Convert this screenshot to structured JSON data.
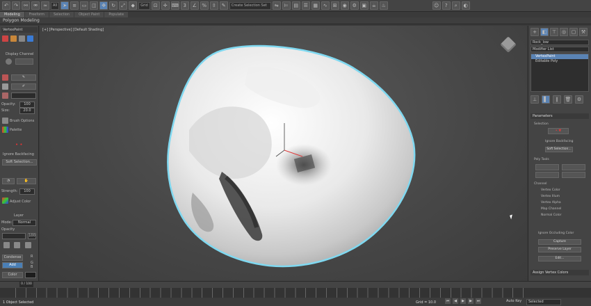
{
  "toolbar": {
    "select_filter": "All",
    "view_label": "Grid",
    "selection_set": "Create Selection Set"
  },
  "ribbon": {
    "tabs": [
      "Modeling",
      "Freeform",
      "Selection",
      "Object Paint",
      "Populate"
    ],
    "active_tab": "Modeling",
    "sub_label": "Polygon Modeling"
  },
  "left_panel": {
    "title": "VertexPaint",
    "display_channel": "Display Channel",
    "opacity_label": "Opacity:",
    "opacity_value": "100",
    "size_label": "Size:",
    "size_value": "20.0",
    "brush_options": "Brush Options",
    "palette": "Palette",
    "ignore_backfacing": "Ignore Backfacing",
    "soft_selection": "Soft Selection...",
    "strength_label": "Strength:",
    "strength_value": "100",
    "adjust_color": "Adjust Color",
    "layer_label": "Layer",
    "mode_label": "Mode:",
    "mode_value": "Normal",
    "opacity2_label": "Opacity",
    "opacity2_value": "100",
    "condense": "Condense",
    "add": "Add",
    "color_label": "Color",
    "r": "R",
    "g": "G",
    "b": "B"
  },
  "viewport": {
    "label": "[+] [Perspective] [Default Shading]"
  },
  "right_panel": {
    "object_name": "Rock_low",
    "modifier_list": "Modifier List",
    "stack": [
      "VertexPaint",
      "Editable Poly"
    ],
    "stack_selected": 0,
    "parameters": "Parameters",
    "selection": "Selection",
    "ignore_backfacing": "Ignore Backfacing",
    "soft_selection": "Soft Selection...",
    "poly_tools": "Poly Tools",
    "channel": "Channel",
    "channels": [
      "Vertex Color",
      "Vertex Illum",
      "Vertex Alpha",
      "Map Channel",
      "Normal Color"
    ],
    "selected_channel": 0,
    "ignore_occluding": "Ignore Occluding Color",
    "capture": "Capture",
    "preserve_layer": "Preserve Layer",
    "edit": "Edit...",
    "assign_vertex_colors": "Assign Vertex Colors"
  },
  "status": {
    "frame_counter": "0 / 100",
    "selected_text": "1 Object Selected",
    "grid_text": "Grid = 10.0",
    "autokey": "Auto Key",
    "selected_dd": "Selected",
    "set_key": "Set Key"
  },
  "colors": {
    "accent_blue": "#5a83b4",
    "rock_outline": "#7fd8f0",
    "gizmo_red": "#e03a3a"
  }
}
